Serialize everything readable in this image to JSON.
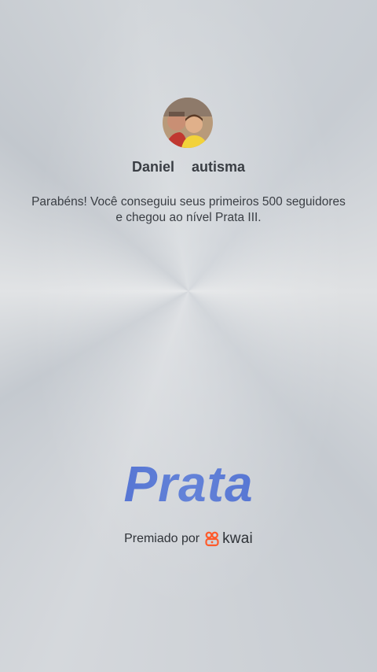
{
  "profile": {
    "first_name": "Daniel",
    "last_name": "autisma"
  },
  "message": "Parabéns! Você conseguiu seus primeiros 500 seguidores e chegou ao nível Prata III.",
  "level": {
    "title": "Prata",
    "color": "#4a68d0"
  },
  "award": {
    "label": "Premiado por",
    "brand_name": "kwai",
    "brand_color": "#ff5a2a",
    "brand_icon": "kwai-logo-icon"
  }
}
